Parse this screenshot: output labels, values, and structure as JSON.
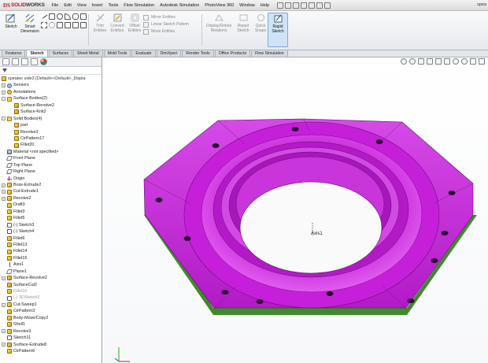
{
  "app": {
    "logo_ds": "DS",
    "logo_solid": "SOLID",
    "logo_works": "WORKS",
    "window_title": "spea"
  },
  "menu": [
    "File",
    "Edit",
    "View",
    "Insert",
    "Tools",
    "Flow Simulation",
    "Autodesk Simulation",
    "PhotoView 360",
    "Window",
    "Help"
  ],
  "command_manager": {
    "sketch": "Sketch",
    "smart_dimension": "Smart Dimension",
    "trim_entities": "Trim Entities",
    "convert_entities": "Convert Entities",
    "offset_entities": "Offset Entities",
    "mirror_entities": "Mirror Entities",
    "linear_pattern": "Linear Sketch Pattern",
    "move_entities": "Move Entities",
    "display_delete": "Display/Delete Relations",
    "repair_sketch": "Repair Sketch",
    "quick_snaps": "Quick Snaps",
    "rapid_sketch": "Rapid Sketch"
  },
  "tabs": [
    "Features",
    "Sketch",
    "Surfaces",
    "Sheet Metal",
    "Mold Tools",
    "Evaluate",
    "DimXpert",
    "Render Tools",
    "Office Products",
    "Flow Simulation"
  ],
  "active_tab": "Sketch",
  "tree": {
    "root": "speaker side3 (Default<<Default>_Displa",
    "items": [
      {
        "label": "Sensors",
        "icon": "sensor",
        "exp": "+"
      },
      {
        "label": "Annotations",
        "icon": "annot",
        "exp": "+"
      },
      {
        "label": "Surface Bodies(2)",
        "icon": "folder",
        "exp": "-"
      },
      {
        "label": "Surface-Revolve2",
        "icon": "surf",
        "indent": 1
      },
      {
        "label": "Surface-Knit2",
        "icon": "surf",
        "indent": 1
      },
      {
        "label": "Solid Bodies(4)",
        "icon": "folder",
        "exp": "-"
      },
      {
        "label": "part",
        "icon": "feat",
        "indent": 1
      },
      {
        "label": "Revolve3",
        "icon": "feat",
        "indent": 1
      },
      {
        "label": "CirPattern17",
        "icon": "feat",
        "indent": 1
      },
      {
        "label": "Fillet20",
        "icon": "feat",
        "indent": 1
      },
      {
        "label": "Material <not specified>",
        "icon": "mat"
      },
      {
        "label": "Front Plane",
        "icon": "plane"
      },
      {
        "label": "Top Plane",
        "icon": "plane"
      },
      {
        "label": "Right Plane",
        "icon": "plane"
      },
      {
        "label": "Origin",
        "icon": "origin"
      },
      {
        "label": "Boss-Extrude2",
        "icon": "feat",
        "exp": "+"
      },
      {
        "label": "Cut-Extrude1",
        "icon": "feat",
        "exp": "+"
      },
      {
        "label": "Revolve2",
        "icon": "feat",
        "exp": "+"
      },
      {
        "label": "Draft3",
        "icon": "feat"
      },
      {
        "label": "Fillet3",
        "icon": "feat"
      },
      {
        "label": "Fillet5",
        "icon": "feat"
      },
      {
        "label": "(-) Sketch3",
        "icon": "sketch"
      },
      {
        "label": "(-) Sketch4",
        "icon": "sketch"
      },
      {
        "label": "Fillet6",
        "icon": "feat"
      },
      {
        "label": "Fillet13",
        "icon": "feat"
      },
      {
        "label": "Fillet14",
        "icon": "feat"
      },
      {
        "label": "Fillet15",
        "icon": "feat"
      },
      {
        "label": "Axis1",
        "icon": "axis"
      },
      {
        "label": "Plane1",
        "icon": "plane"
      },
      {
        "label": "Surface-Revolve2",
        "icon": "surf",
        "exp": "+"
      },
      {
        "label": "SurfaceCut2",
        "icon": "surf"
      },
      {
        "label": "Fillet10",
        "icon": "feat",
        "dim": true
      },
      {
        "label": "(-) 3DSketch3",
        "icon": "sketch",
        "dim": true
      },
      {
        "label": "Cut-Sweep1",
        "icon": "feat",
        "exp": "+"
      },
      {
        "label": "CirPattern3",
        "icon": "feat"
      },
      {
        "label": "Body-Move/Copy2",
        "icon": "feat"
      },
      {
        "label": "Shell1",
        "icon": "feat"
      },
      {
        "label": "Revolve3",
        "icon": "feat",
        "exp": "+"
      },
      {
        "label": "Sketch11",
        "icon": "sketch"
      },
      {
        "label": "Surface-Extrude8",
        "icon": "surf",
        "exp": "+"
      },
      {
        "label": "CirPattern6",
        "icon": "feat"
      }
    ]
  },
  "viewport": {
    "axis_label": "Axis1",
    "part_color": "#c21fd6",
    "edge_color": "#3f8a2c"
  }
}
